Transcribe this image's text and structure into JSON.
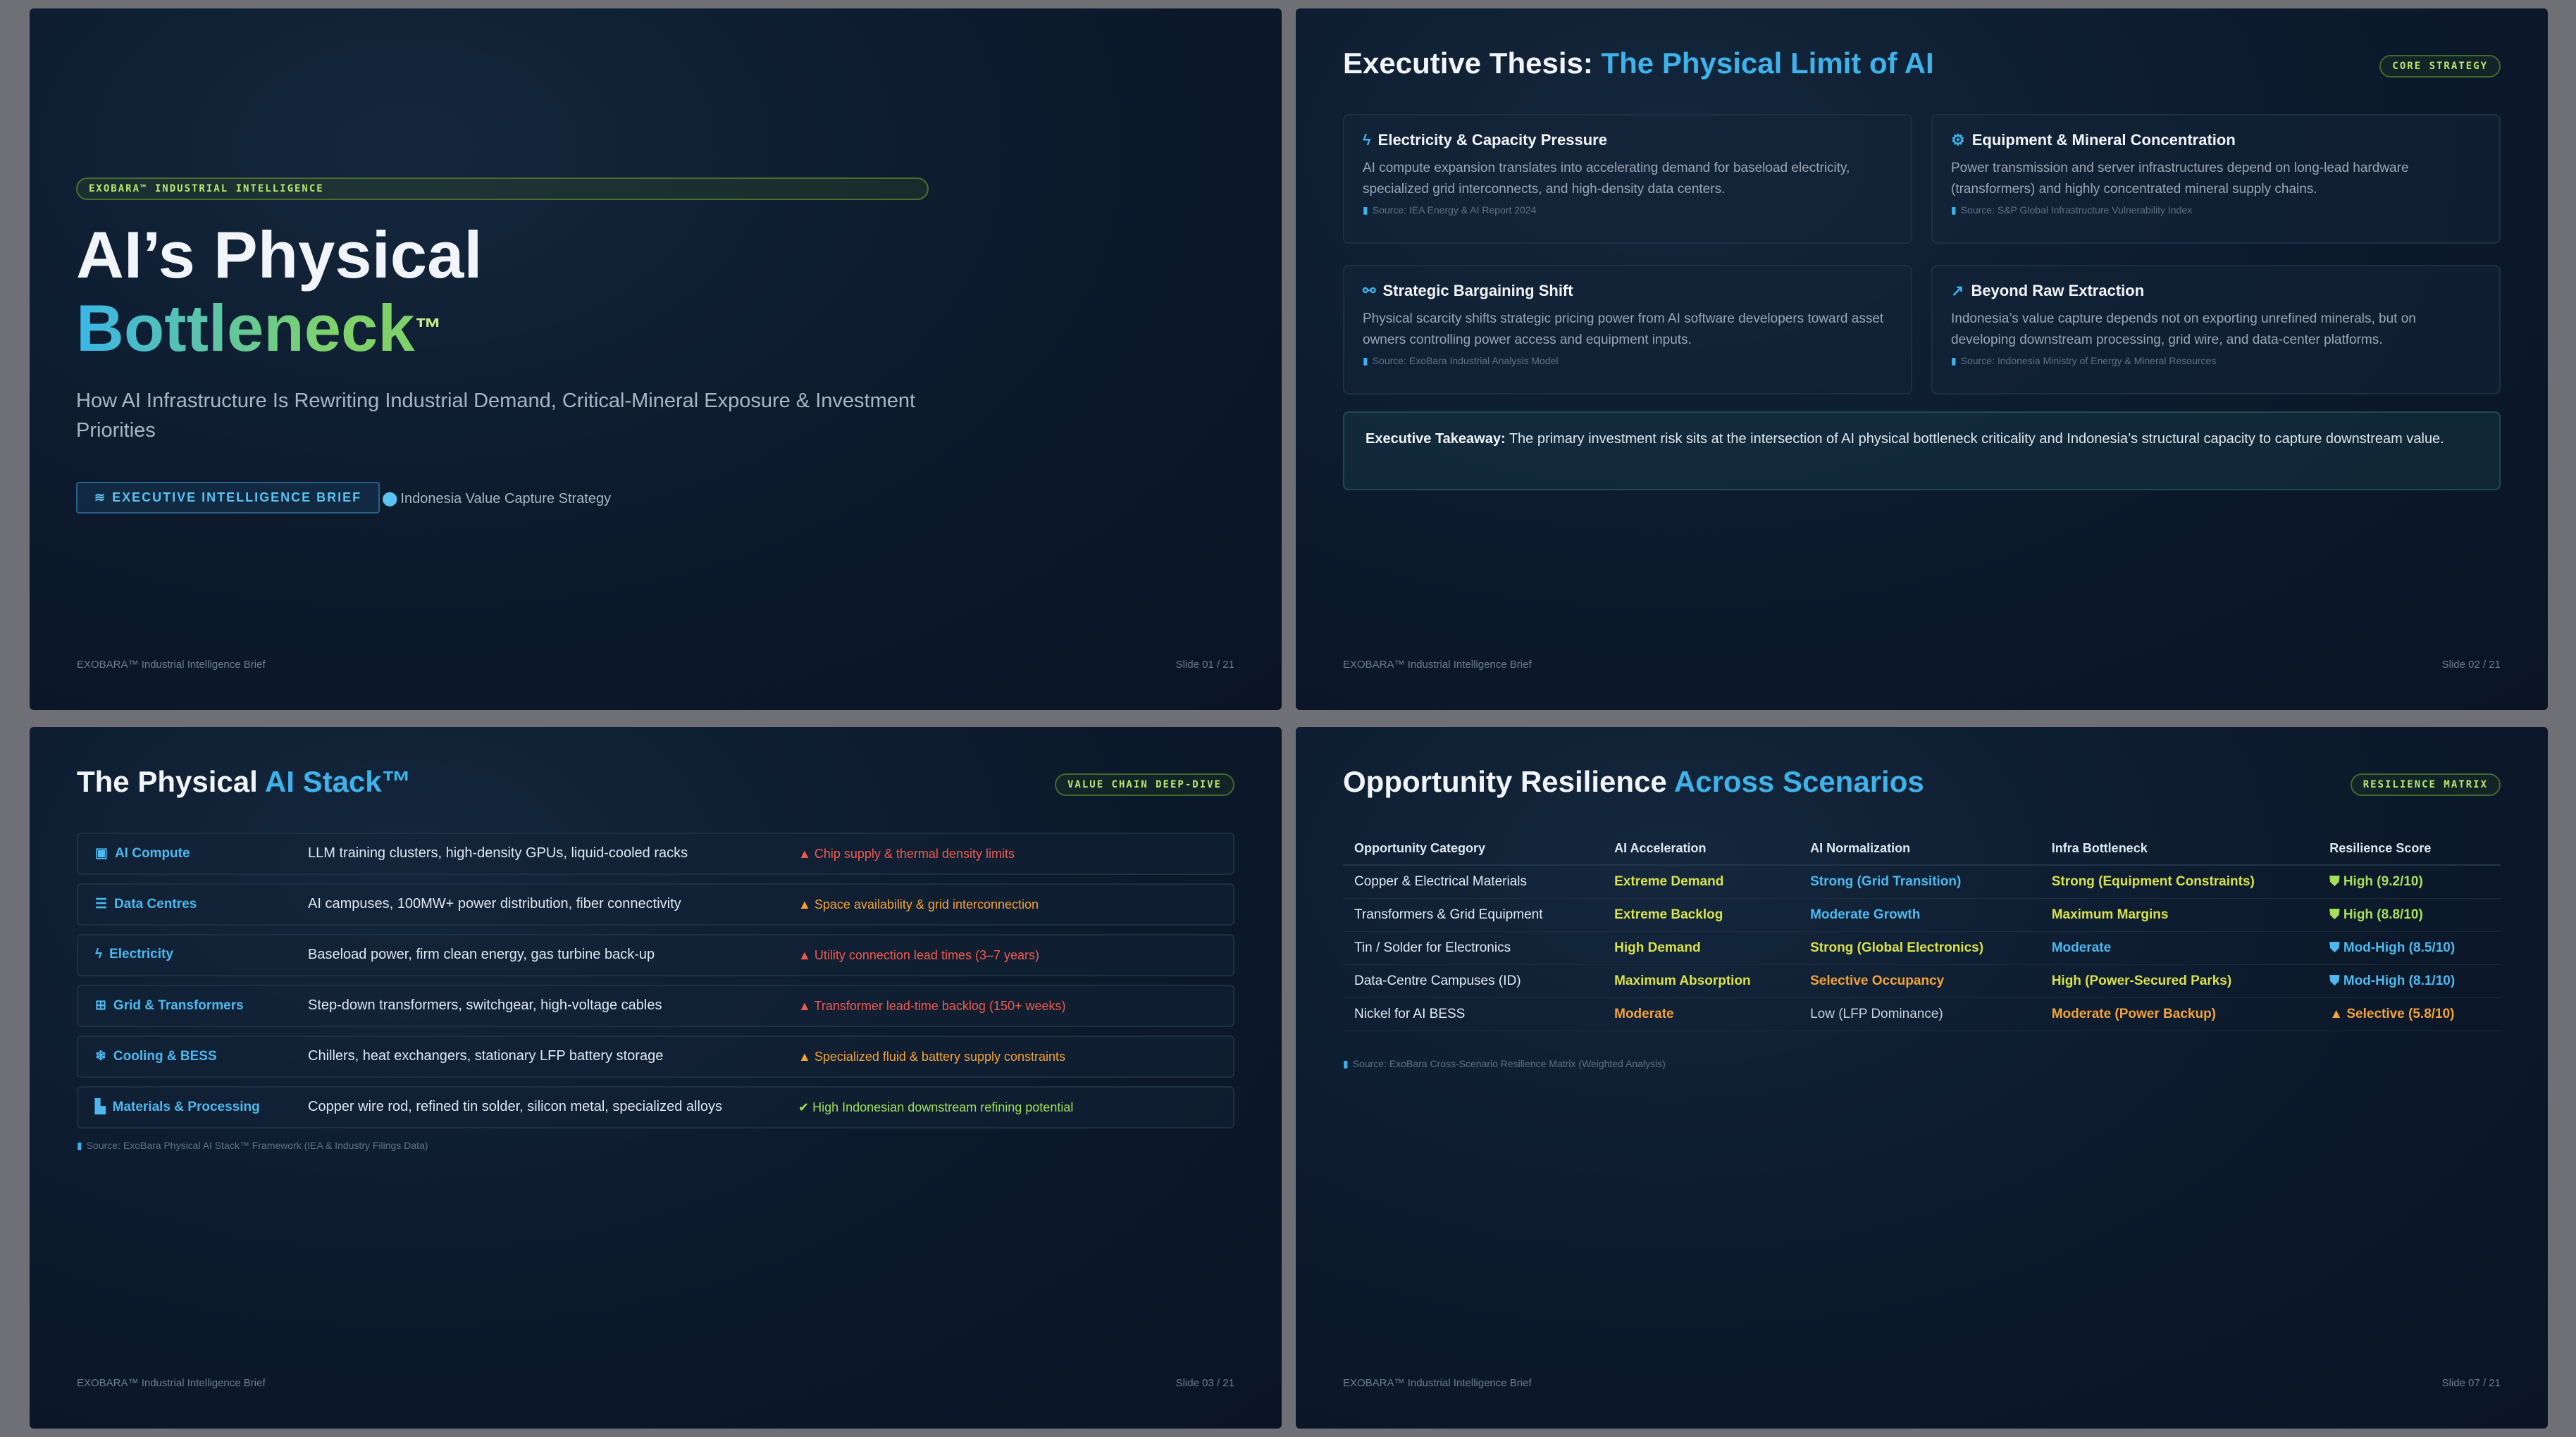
{
  "footer_brand": "EXOBARA™ Industrial Intelligence Brief",
  "slide1": {
    "brand_pill": "EXOBARA™ INDUSTRIAL INTELLIGENCE",
    "title_line1": "AI’s Physical",
    "title_line2": "Bottleneck",
    "title_tm": "™",
    "subtitle": "How AI Infrastructure Is Rewriting Industrial Demand, Critical-Mineral Exposure & Investment Priorities",
    "brief_button": "EXECUTIVE INTELLIGENCE BRIEF",
    "location": "Indonesia Value Capture Strategy",
    "slide_number": "Slide 01 / 21"
  },
  "slide2": {
    "title": "Executive Thesis:",
    "title_accent": "The Physical Limit of AI",
    "tag": "CORE STRATEGY",
    "cards": [
      {
        "icon": "bolt-icon",
        "heading": "Electricity & Capacity Pressure",
        "body": "AI compute expansion translates into accelerating demand for baseload electricity, specialized grid interconnects, and high-density data centers.",
        "source": "Source: IEA Energy & AI Report 2024"
      },
      {
        "icon": "gears-icon",
        "heading": "Equipment & Mineral Concentration",
        "body": "Power transmission and server infrastructures depend on long-lead hardware (transformers) and highly concentrated mineral supply chains.",
        "source": "Source: S&P Global Infrastructure Vulnerability Index"
      },
      {
        "icon": "network-icon",
        "heading": "Strategic Bargaining Shift",
        "body": "Physical scarcity shifts strategic pricing power from AI software developers toward asset owners controlling power access and equipment inputs.",
        "source": "Source: ExoBara Industrial Analysis Model"
      },
      {
        "icon": "trend-up-icon",
        "heading": "Beyond Raw Extraction",
        "body": "Indonesia’s value capture depends not on exporting unrefined minerals, but on developing downstream processing, grid wire, and data-center platforms.",
        "source": "Source: Indonesia Ministry of Energy & Mineral Resources"
      }
    ],
    "takeaway_label": "Executive Takeaway:",
    "takeaway_text": " The primary investment risk sits at the intersection of AI physical bottleneck criticality and Indonesia’s structural capacity to capture downstream value.",
    "slide_number": "Slide 02 / 21"
  },
  "slide3": {
    "title": "The Physical",
    "title_accent": "AI Stack™",
    "tag": "VALUE CHAIN DEEP-DIVE",
    "rows": [
      {
        "name": "AI Compute",
        "icon": "chip-icon",
        "desc": "LLM training clusters, high-density GPUs, liquid-cooled racks",
        "risk": "Chip supply & thermal density limits",
        "level": "red"
      },
      {
        "name": "Data Centres",
        "icon": "server-icon",
        "desc": "AI campuses, 100MW+ power distribution, fiber connectivity",
        "risk": "Space availability & grid interconnection",
        "level": "orange"
      },
      {
        "name": "Electricity",
        "icon": "bolt-icon",
        "desc": "Baseload power, firm clean energy, gas turbine back-up",
        "risk": "Utility connection lead times (3–7 years)",
        "level": "red"
      },
      {
        "name": "Grid & Transformers",
        "icon": "grid-icon",
        "desc": "Step-down transformers, switchgear, high-voltage cables",
        "risk": "Transformer lead-time backlog (150+ weeks)",
        "level": "red"
      },
      {
        "name": "Cooling & BESS",
        "icon": "snowflake-icon",
        "desc": "Chillers, heat exchangers, stationary LFP battery storage",
        "risk": "Specialized fluid & battery supply constraints",
        "level": "orange"
      },
      {
        "name": "Materials & Processing",
        "icon": "factory-icon",
        "desc": "Copper wire rod, refined tin solder, silicon metal, specialized alloys",
        "risk": "High Indonesian downstream refining potential",
        "level": "green"
      }
    ],
    "source": "Source: ExoBara Physical AI Stack™ Framework (IEA & Industry Filings Data)",
    "slide_number": "Slide 03 / 21"
  },
  "slide4": {
    "title": "Opportunity Resilience",
    "title_accent": "Across Scenarios",
    "tag": "RESILIENCE MATRIX",
    "columns": [
      "Opportunity Category",
      "AI Acceleration",
      "AI Normalization",
      "Infra Bottleneck",
      "Resilience Score"
    ],
    "rows": [
      {
        "category": "Copper & Electrical Materials",
        "accel": "Extreme Demand",
        "accel_c": "yellow",
        "norm": "Strong (Grid Transition)",
        "norm_c": "blue",
        "infra": "Strong (Equipment Constraints)",
        "infra_c": "yellow",
        "score": "High (9.2/10)",
        "score_c": "score-green",
        "score_icon": "shield-icon"
      },
      {
        "category": "Transformers & Grid Equipment",
        "accel": "Extreme Backlog",
        "accel_c": "yellow",
        "norm": "Moderate Growth",
        "norm_c": "blue",
        "infra": "Maximum Margins",
        "infra_c": "yellow",
        "score": "High (8.8/10)",
        "score_c": "score-green",
        "score_icon": "shield-icon"
      },
      {
        "category": "Tin / Solder for Electronics",
        "accel": "High Demand",
        "accel_c": "yellow",
        "norm": "Strong (Global Electronics)",
        "norm_c": "yellow",
        "infra": "Moderate",
        "infra_c": "blue",
        "score": "Mod-High (8.5/10)",
        "score_c": "score-blue",
        "score_icon": "shield-icon"
      },
      {
        "category": "Data-Centre Campuses (ID)",
        "accel": "Maximum Absorption",
        "accel_c": "yellow",
        "norm": "Selective Occupancy",
        "norm_c": "orange",
        "infra": "High (Power-Secured Parks)",
        "infra_c": "yellow",
        "score": "Mod-High (8.1/10)",
        "score_c": "score-blue",
        "score_icon": "shield-icon"
      },
      {
        "category": "Nickel for AI BESS",
        "accel": "Moderate",
        "accel_c": "orange",
        "norm": "Low (LFP Dominance)",
        "norm_c": "grey",
        "infra": "Moderate (Power Backup)",
        "infra_c": "orange",
        "score": "Selective (5.8/10)",
        "score_c": "score-orange",
        "score_icon": "warning-icon"
      }
    ],
    "source": "Source: ExoBara Cross-Scenario Resilience Matrix (Weighted Analysis)",
    "slide_number": "Slide 07 / 21"
  }
}
